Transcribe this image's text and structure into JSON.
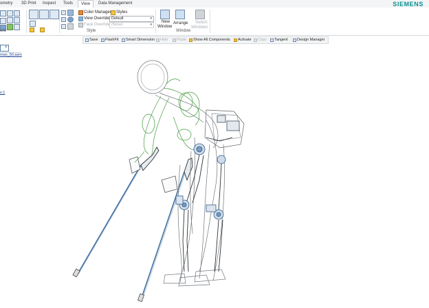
{
  "tabs": [
    {
      "label": "ometry",
      "active": false
    },
    {
      "label": "3D Print",
      "active": false
    },
    {
      "label": "Inspect",
      "active": false
    },
    {
      "label": "Tools",
      "active": false
    },
    {
      "label": "View",
      "active": true
    },
    {
      "label": "Data Management",
      "active": false
    }
  ],
  "brand": "SIEMENS",
  "ribbon": {
    "left_group_label": "ent",
    "style": {
      "color_manager": "Color Manager",
      "styles": "Styles",
      "view_overrides": "View Overrides",
      "view_overrides_value": "Default",
      "face_overrides": "Face Overrides",
      "face_overrides_value": "(None)",
      "group_label": "Style"
    },
    "window": {
      "new_window_line1": "New",
      "new_window_line2": "Window",
      "arrange": "Arrange",
      "switch_windows_line1": "Switch",
      "switch_windows_line2": "Windows",
      "group_label": "Window"
    }
  },
  "toolbar": {
    "save": "Save",
    "flashfit": "FlashFit",
    "smart_dimension": "Smart Dimension",
    "hide": "Hide",
    "paste": "Paste",
    "show_all": "Show All Components",
    "activate": "Activate",
    "copy": "Copy",
    "tangent": "Tangent",
    "design_manager": "Design Manager"
  },
  "left_panel": {
    "close": "×",
    "file_name": "man_50.asm",
    "item": "s:1"
  },
  "colors": {
    "accent": "#0a8f92",
    "wireframe_gray": "#6f747a",
    "wireframe_green": "#3f9a3a",
    "wireframe_blue": "#2e5b8c",
    "crutch_blue": "#3f6f9f"
  }
}
